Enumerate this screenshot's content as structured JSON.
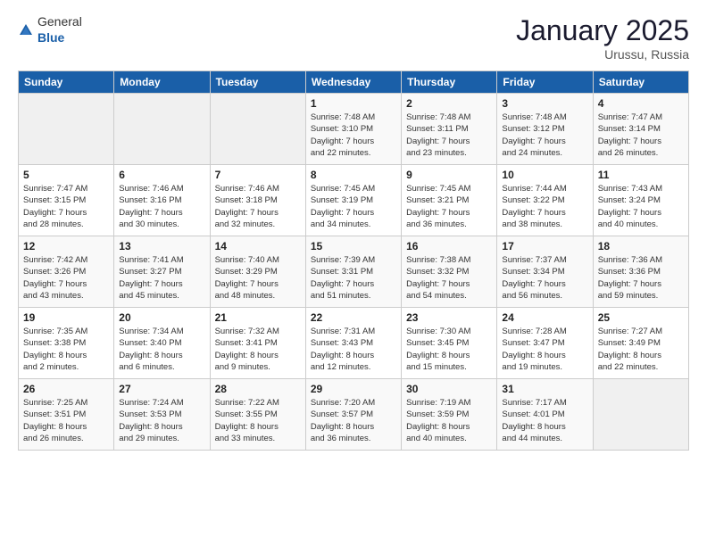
{
  "header": {
    "logo": {
      "general": "General",
      "blue": "Blue"
    },
    "title": "January 2025",
    "location": "Urussu, Russia"
  },
  "weekdays": [
    "Sunday",
    "Monday",
    "Tuesday",
    "Wednesday",
    "Thursday",
    "Friday",
    "Saturday"
  ],
  "weeks": [
    [
      {
        "day": "",
        "info": ""
      },
      {
        "day": "",
        "info": ""
      },
      {
        "day": "",
        "info": ""
      },
      {
        "day": "1",
        "info": "Sunrise: 7:48 AM\nSunset: 3:10 PM\nDaylight: 7 hours\nand 22 minutes."
      },
      {
        "day": "2",
        "info": "Sunrise: 7:48 AM\nSunset: 3:11 PM\nDaylight: 7 hours\nand 23 minutes."
      },
      {
        "day": "3",
        "info": "Sunrise: 7:48 AM\nSunset: 3:12 PM\nDaylight: 7 hours\nand 24 minutes."
      },
      {
        "day": "4",
        "info": "Sunrise: 7:47 AM\nSunset: 3:14 PM\nDaylight: 7 hours\nand 26 minutes."
      }
    ],
    [
      {
        "day": "5",
        "info": "Sunrise: 7:47 AM\nSunset: 3:15 PM\nDaylight: 7 hours\nand 28 minutes."
      },
      {
        "day": "6",
        "info": "Sunrise: 7:46 AM\nSunset: 3:16 PM\nDaylight: 7 hours\nand 30 minutes."
      },
      {
        "day": "7",
        "info": "Sunrise: 7:46 AM\nSunset: 3:18 PM\nDaylight: 7 hours\nand 32 minutes."
      },
      {
        "day": "8",
        "info": "Sunrise: 7:45 AM\nSunset: 3:19 PM\nDaylight: 7 hours\nand 34 minutes."
      },
      {
        "day": "9",
        "info": "Sunrise: 7:45 AM\nSunset: 3:21 PM\nDaylight: 7 hours\nand 36 minutes."
      },
      {
        "day": "10",
        "info": "Sunrise: 7:44 AM\nSunset: 3:22 PM\nDaylight: 7 hours\nand 38 minutes."
      },
      {
        "day": "11",
        "info": "Sunrise: 7:43 AM\nSunset: 3:24 PM\nDaylight: 7 hours\nand 40 minutes."
      }
    ],
    [
      {
        "day": "12",
        "info": "Sunrise: 7:42 AM\nSunset: 3:26 PM\nDaylight: 7 hours\nand 43 minutes."
      },
      {
        "day": "13",
        "info": "Sunrise: 7:41 AM\nSunset: 3:27 PM\nDaylight: 7 hours\nand 45 minutes."
      },
      {
        "day": "14",
        "info": "Sunrise: 7:40 AM\nSunset: 3:29 PM\nDaylight: 7 hours\nand 48 minutes."
      },
      {
        "day": "15",
        "info": "Sunrise: 7:39 AM\nSunset: 3:31 PM\nDaylight: 7 hours\nand 51 minutes."
      },
      {
        "day": "16",
        "info": "Sunrise: 7:38 AM\nSunset: 3:32 PM\nDaylight: 7 hours\nand 54 minutes."
      },
      {
        "day": "17",
        "info": "Sunrise: 7:37 AM\nSunset: 3:34 PM\nDaylight: 7 hours\nand 56 minutes."
      },
      {
        "day": "18",
        "info": "Sunrise: 7:36 AM\nSunset: 3:36 PM\nDaylight: 7 hours\nand 59 minutes."
      }
    ],
    [
      {
        "day": "19",
        "info": "Sunrise: 7:35 AM\nSunset: 3:38 PM\nDaylight: 8 hours\nand 2 minutes."
      },
      {
        "day": "20",
        "info": "Sunrise: 7:34 AM\nSunset: 3:40 PM\nDaylight: 8 hours\nand 6 minutes."
      },
      {
        "day": "21",
        "info": "Sunrise: 7:32 AM\nSunset: 3:41 PM\nDaylight: 8 hours\nand 9 minutes."
      },
      {
        "day": "22",
        "info": "Sunrise: 7:31 AM\nSunset: 3:43 PM\nDaylight: 8 hours\nand 12 minutes."
      },
      {
        "day": "23",
        "info": "Sunrise: 7:30 AM\nSunset: 3:45 PM\nDaylight: 8 hours\nand 15 minutes."
      },
      {
        "day": "24",
        "info": "Sunrise: 7:28 AM\nSunset: 3:47 PM\nDaylight: 8 hours\nand 19 minutes."
      },
      {
        "day": "25",
        "info": "Sunrise: 7:27 AM\nSunset: 3:49 PM\nDaylight: 8 hours\nand 22 minutes."
      }
    ],
    [
      {
        "day": "26",
        "info": "Sunrise: 7:25 AM\nSunset: 3:51 PM\nDaylight: 8 hours\nand 26 minutes."
      },
      {
        "day": "27",
        "info": "Sunrise: 7:24 AM\nSunset: 3:53 PM\nDaylight: 8 hours\nand 29 minutes."
      },
      {
        "day": "28",
        "info": "Sunrise: 7:22 AM\nSunset: 3:55 PM\nDaylight: 8 hours\nand 33 minutes."
      },
      {
        "day": "29",
        "info": "Sunrise: 7:20 AM\nSunset: 3:57 PM\nDaylight: 8 hours\nand 36 minutes."
      },
      {
        "day": "30",
        "info": "Sunrise: 7:19 AM\nSunset: 3:59 PM\nDaylight: 8 hours\nand 40 minutes."
      },
      {
        "day": "31",
        "info": "Sunrise: 7:17 AM\nSunset: 4:01 PM\nDaylight: 8 hours\nand 44 minutes."
      },
      {
        "day": "",
        "info": ""
      }
    ]
  ]
}
